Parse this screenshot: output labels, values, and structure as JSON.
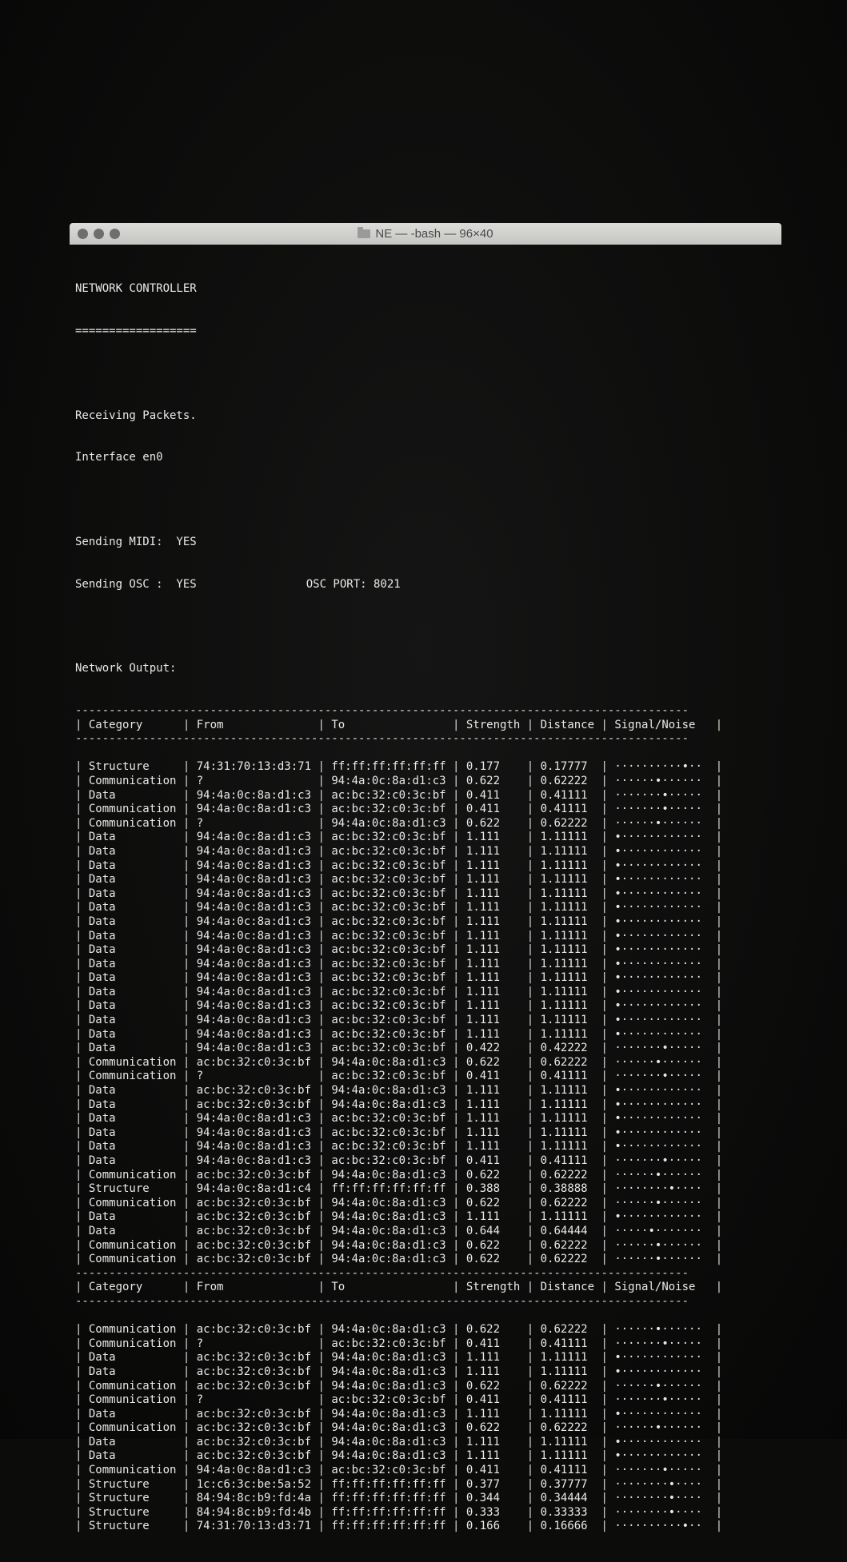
{
  "window": {
    "title": "NE — -bash — 96×40"
  },
  "header": {
    "app_name": "NETWORK CONTROLLER",
    "underline": "==================",
    "status": "Receiving Packets.",
    "interface": "Interface en0",
    "sending_midi": "Sending MIDI:  YES",
    "sending_osc": "Sending OSC :  YES",
    "osc_port": "OSC PORT: 8021",
    "output_label": "Network Output:"
  },
  "table": {
    "rule": "-------------------------------------------------------------------------------------------",
    "columns": [
      "Category",
      "From",
      "To",
      "Strength",
      "Distance",
      "Signal/Noise"
    ],
    "sections": [
      {
        "rows": [
          [
            "Structure",
            "74:31:70:13:d3:71",
            "ff:ff:ff:ff:ff:ff",
            "0.177",
            "0.17777",
            "··········•··"
          ],
          [
            "Communication",
            "?",
            "94:4a:0c:8a:d1:c3",
            "0.622",
            "0.62222",
            "······•······"
          ],
          [
            "Data",
            "94:4a:0c:8a:d1:c3",
            "ac:bc:32:c0:3c:bf",
            "0.411",
            "0.41111",
            "·······•·····"
          ],
          [
            "Communication",
            "94:4a:0c:8a:d1:c3",
            "ac:bc:32:c0:3c:bf",
            "0.411",
            "0.41111",
            "·······•·····"
          ],
          [
            "Communication",
            "?",
            "94:4a:0c:8a:d1:c3",
            "0.622",
            "0.62222",
            "······•······"
          ],
          [
            "Data",
            "94:4a:0c:8a:d1:c3",
            "ac:bc:32:c0:3c:bf",
            "1.111",
            "1.11111",
            "•············"
          ],
          [
            "Data",
            "94:4a:0c:8a:d1:c3",
            "ac:bc:32:c0:3c:bf",
            "1.111",
            "1.11111",
            "•············"
          ],
          [
            "Data",
            "94:4a:0c:8a:d1:c3",
            "ac:bc:32:c0:3c:bf",
            "1.111",
            "1.11111",
            "•············"
          ],
          [
            "Data",
            "94:4a:0c:8a:d1:c3",
            "ac:bc:32:c0:3c:bf",
            "1.111",
            "1.11111",
            "•············"
          ],
          [
            "Data",
            "94:4a:0c:8a:d1:c3",
            "ac:bc:32:c0:3c:bf",
            "1.111",
            "1.11111",
            "•············"
          ],
          [
            "Data",
            "94:4a:0c:8a:d1:c3",
            "ac:bc:32:c0:3c:bf",
            "1.111",
            "1.11111",
            "•············"
          ],
          [
            "Data",
            "94:4a:0c:8a:d1:c3",
            "ac:bc:32:c0:3c:bf",
            "1.111",
            "1.11111",
            "•············"
          ],
          [
            "Data",
            "94:4a:0c:8a:d1:c3",
            "ac:bc:32:c0:3c:bf",
            "1.111",
            "1.11111",
            "•············"
          ],
          [
            "Data",
            "94:4a:0c:8a:d1:c3",
            "ac:bc:32:c0:3c:bf",
            "1.111",
            "1.11111",
            "•············"
          ],
          [
            "Data",
            "94:4a:0c:8a:d1:c3",
            "ac:bc:32:c0:3c:bf",
            "1.111",
            "1.11111",
            "•············"
          ],
          [
            "Data",
            "94:4a:0c:8a:d1:c3",
            "ac:bc:32:c0:3c:bf",
            "1.111",
            "1.11111",
            "•············"
          ],
          [
            "Data",
            "94:4a:0c:8a:d1:c3",
            "ac:bc:32:c0:3c:bf",
            "1.111",
            "1.11111",
            "•············"
          ],
          [
            "Data",
            "94:4a:0c:8a:d1:c3",
            "ac:bc:32:c0:3c:bf",
            "1.111",
            "1.11111",
            "•············"
          ],
          [
            "Data",
            "94:4a:0c:8a:d1:c3",
            "ac:bc:32:c0:3c:bf",
            "1.111",
            "1.11111",
            "•············"
          ],
          [
            "Data",
            "94:4a:0c:8a:d1:c3",
            "ac:bc:32:c0:3c:bf",
            "1.111",
            "1.11111",
            "•············"
          ],
          [
            "Data",
            "94:4a:0c:8a:d1:c3",
            "ac:bc:32:c0:3c:bf",
            "0.422",
            "0.42222",
            "·······•·····"
          ],
          [
            "Communication",
            "ac:bc:32:c0:3c:bf",
            "94:4a:0c:8a:d1:c3",
            "0.622",
            "0.62222",
            "······•······"
          ],
          [
            "Communication",
            "?",
            "ac:bc:32:c0:3c:bf",
            "0.411",
            "0.41111",
            "·······•·····"
          ],
          [
            "Data",
            "ac:bc:32:c0:3c:bf",
            "94:4a:0c:8a:d1:c3",
            "1.111",
            "1.11111",
            "•············"
          ],
          [
            "Data",
            "ac:bc:32:c0:3c:bf",
            "94:4a:0c:8a:d1:c3",
            "1.111",
            "1.11111",
            "•············"
          ],
          [
            "Data",
            "94:4a:0c:8a:d1:c3",
            "ac:bc:32:c0:3c:bf",
            "1.111",
            "1.11111",
            "•············"
          ],
          [
            "Data",
            "94:4a:0c:8a:d1:c3",
            "ac:bc:32:c0:3c:bf",
            "1.111",
            "1.11111",
            "•············"
          ],
          [
            "Data",
            "94:4a:0c:8a:d1:c3",
            "ac:bc:32:c0:3c:bf",
            "1.111",
            "1.11111",
            "•············"
          ],
          [
            "Data",
            "94:4a:0c:8a:d1:c3",
            "ac:bc:32:c0:3c:bf",
            "0.411",
            "0.41111",
            "·······•·····"
          ],
          [
            "Communication",
            "ac:bc:32:c0:3c:bf",
            "94:4a:0c:8a:d1:c3",
            "0.622",
            "0.62222",
            "······•······"
          ],
          [
            "Structure",
            "94:4a:0c:8a:d1:c4",
            "ff:ff:ff:ff:ff:ff",
            "0.388",
            "0.38888",
            "········•····"
          ],
          [
            "Communication",
            "ac:bc:32:c0:3c:bf",
            "94:4a:0c:8a:d1:c3",
            "0.622",
            "0.62222",
            "······•······"
          ],
          [
            "Data",
            "ac:bc:32:c0:3c:bf",
            "94:4a:0c:8a:d1:c3",
            "1.111",
            "1.11111",
            "•············"
          ],
          [
            "Data",
            "ac:bc:32:c0:3c:bf",
            "94:4a:0c:8a:d1:c3",
            "0.644",
            "0.64444",
            "·····•·······"
          ],
          [
            "Communication",
            "ac:bc:32:c0:3c:bf",
            "94:4a:0c:8a:d1:c3",
            "0.622",
            "0.62222",
            "······•······"
          ],
          [
            "Communication",
            "ac:bc:32:c0:3c:bf",
            "94:4a:0c:8a:d1:c3",
            "0.622",
            "0.62222",
            "······•······"
          ]
        ]
      },
      {
        "rows": [
          [
            "Communication",
            "ac:bc:32:c0:3c:bf",
            "94:4a:0c:8a:d1:c3",
            "0.622",
            "0.62222",
            "······•······"
          ],
          [
            "Communication",
            "?",
            "ac:bc:32:c0:3c:bf",
            "0.411",
            "0.41111",
            "·······•·····"
          ],
          [
            "Data",
            "ac:bc:32:c0:3c:bf",
            "94:4a:0c:8a:d1:c3",
            "1.111",
            "1.11111",
            "•············"
          ],
          [
            "Data",
            "ac:bc:32:c0:3c:bf",
            "94:4a:0c:8a:d1:c3",
            "1.111",
            "1.11111",
            "•············"
          ],
          [
            "Communication",
            "ac:bc:32:c0:3c:bf",
            "94:4a:0c:8a:d1:c3",
            "0.622",
            "0.62222",
            "······•······"
          ],
          [
            "Communication",
            "?",
            "ac:bc:32:c0:3c:bf",
            "0.411",
            "0.41111",
            "·······•·····"
          ],
          [
            "Data",
            "ac:bc:32:c0:3c:bf",
            "94:4a:0c:8a:d1:c3",
            "1.111",
            "1.11111",
            "•············"
          ],
          [
            "Communication",
            "ac:bc:32:c0:3c:bf",
            "94:4a:0c:8a:d1:c3",
            "0.622",
            "0.62222",
            "······•······"
          ],
          [
            "Data",
            "ac:bc:32:c0:3c:bf",
            "94:4a:0c:8a:d1:c3",
            "1.111",
            "1.11111",
            "•············"
          ],
          [
            "Data",
            "ac:bc:32:c0:3c:bf",
            "94:4a:0c:8a:d1:c3",
            "1.111",
            "1.11111",
            "•············"
          ],
          [
            "Communication",
            "94:4a:0c:8a:d1:c3",
            "ac:bc:32:c0:3c:bf",
            "0.411",
            "0.41111",
            "·······•·····"
          ],
          [
            "Structure",
            "1c:c6:3c:be:5a:52",
            "ff:ff:ff:ff:ff:ff",
            "0.377",
            "0.37777",
            "········•····"
          ],
          [
            "Structure",
            "84:94:8c:b9:fd:4a",
            "ff:ff:ff:ff:ff:ff",
            "0.344",
            "0.34444",
            "········•····"
          ],
          [
            "Structure",
            "84:94:8c:b9:fd:4b",
            "ff:ff:ff:ff:ff:ff",
            "0.333",
            "0.33333",
            "········•····"
          ],
          [
            "Structure",
            "74:31:70:13:d3:71",
            "ff:ff:ff:ff:ff:ff",
            "0.166",
            "0.16666",
            "··········•··"
          ]
        ]
      }
    ]
  }
}
